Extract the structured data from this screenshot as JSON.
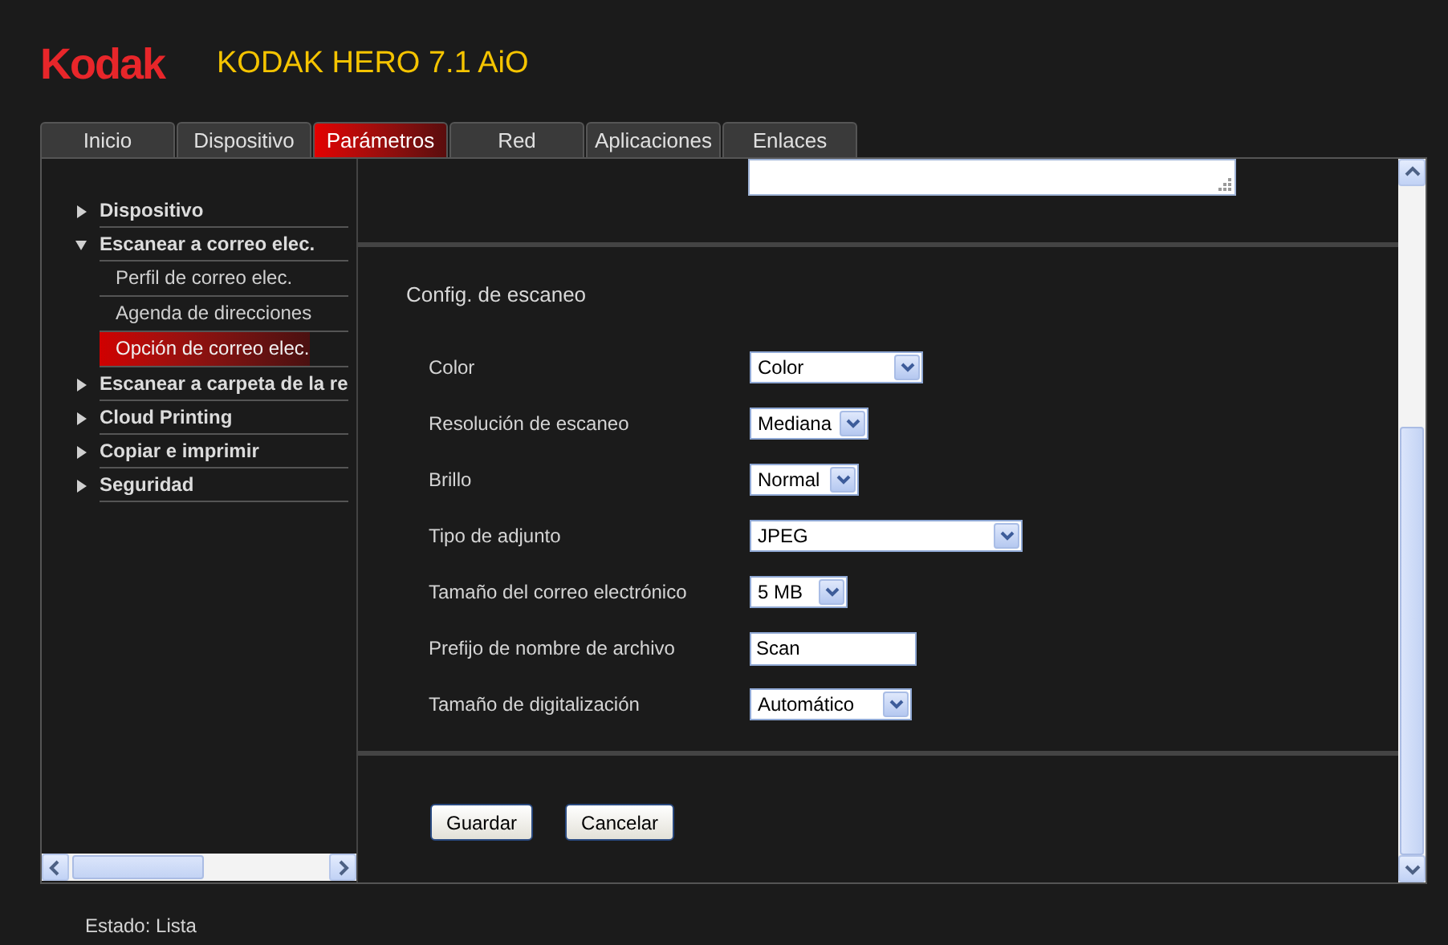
{
  "header": {
    "logo": "Kodak",
    "title": "KODAK HERO 7.1 AiO"
  },
  "tabs": [
    {
      "label": "Inicio",
      "selected": false
    },
    {
      "label": "Dispositivo",
      "selected": false
    },
    {
      "label": "Parámetros",
      "selected": true
    },
    {
      "label": "Red",
      "selected": false
    },
    {
      "label": "Aplicaciones",
      "selected": false
    },
    {
      "label": "Enlaces",
      "selected": false
    }
  ],
  "sidebar": {
    "items": [
      {
        "label": "Dispositivo",
        "expanded": false
      },
      {
        "label": "Escanear a correo elec.",
        "expanded": true,
        "children": [
          {
            "label": "Perfil de correo elec.",
            "selected": false
          },
          {
            "label": "Agenda de direcciones",
            "selected": false
          },
          {
            "label": "Opción de correo elec.",
            "selected": true
          }
        ]
      },
      {
        "label": "Escanear a carpeta de la re",
        "expanded": false
      },
      {
        "label": "Cloud Printing",
        "expanded": false
      },
      {
        "label": "Copiar e imprimir",
        "expanded": false
      },
      {
        "label": "Seguridad",
        "expanded": false
      }
    ]
  },
  "section": {
    "title": "Config. de escaneo",
    "fields": [
      {
        "label": "Color",
        "kind": "select",
        "value": "Color"
      },
      {
        "label": "Resolución de escaneo",
        "kind": "select",
        "value": "Mediana"
      },
      {
        "label": "Brillo",
        "kind": "select",
        "value": "Normal"
      },
      {
        "label": "Tipo de adjunto",
        "kind": "select",
        "value": "JPEG"
      },
      {
        "label": "Tamaño del correo electrónico",
        "kind": "select",
        "value": "5 MB"
      },
      {
        "label": "Prefijo de nombre de archivo",
        "kind": "text",
        "value": "Scan"
      },
      {
        "label": "Tamaño de digitalización",
        "kind": "select",
        "value": "Automático"
      }
    ]
  },
  "buttons": [
    "Guardar",
    "Cancelar"
  ],
  "status_bar": "Estado: Lista"
}
